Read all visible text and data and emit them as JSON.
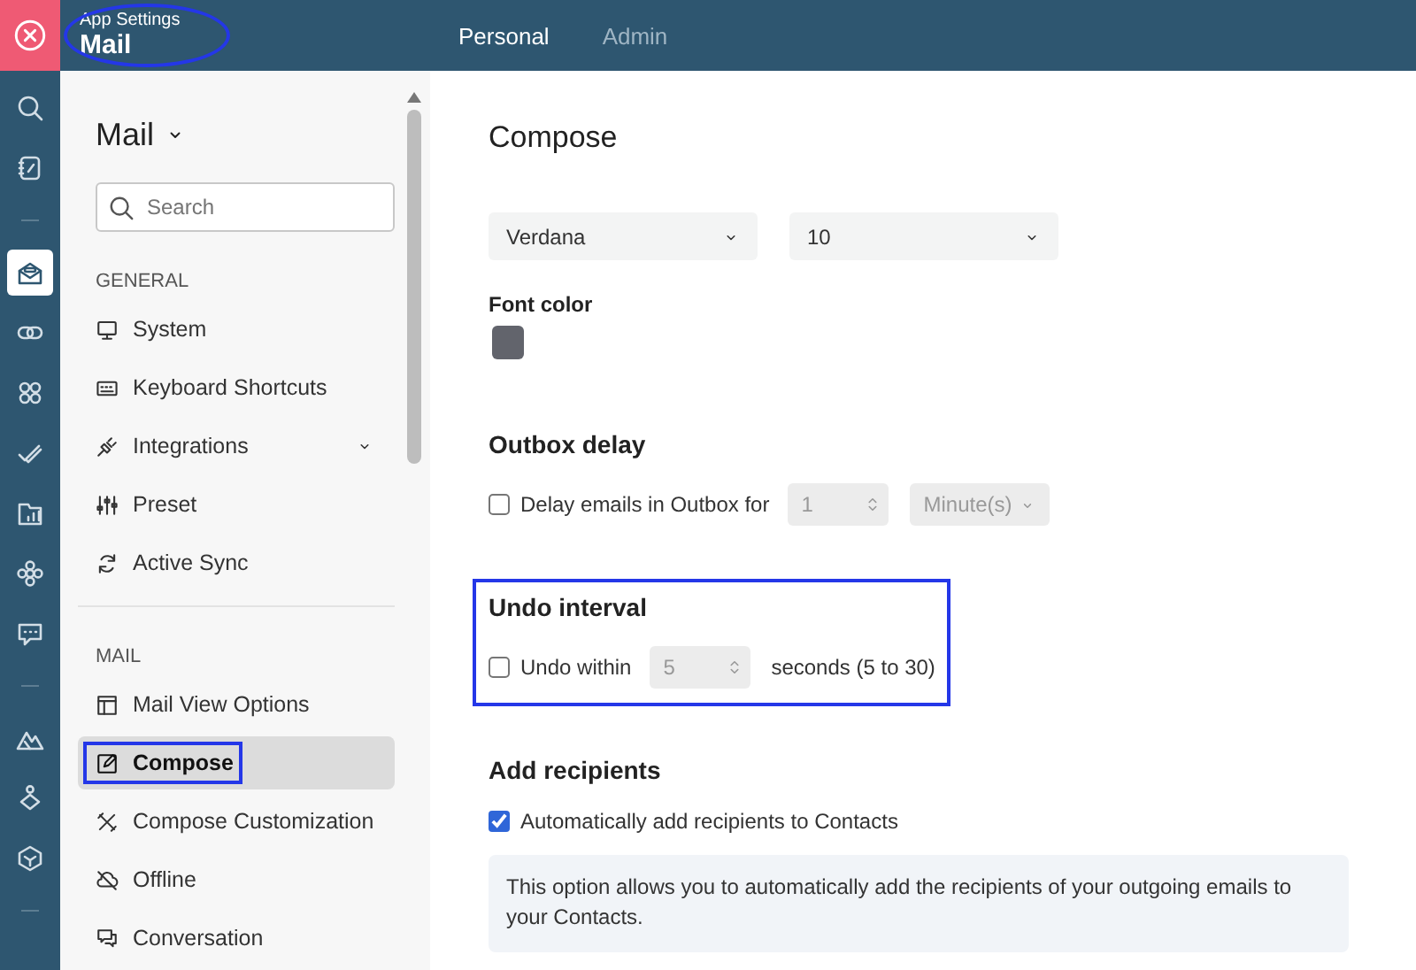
{
  "header": {
    "app_label": "App Settings",
    "title": "Mail",
    "title_circled": true,
    "tabs": [
      {
        "label": "Personal",
        "selected": true
      },
      {
        "label": "Admin",
        "selected": false
      }
    ]
  },
  "rail": {
    "groups": [
      [
        {
          "selected": false
        },
        {
          "selected": false
        }
      ],
      [
        {
          "selected": true
        },
        {
          "selected": false
        },
        {
          "selected": false
        },
        {
          "selected": false
        },
        {
          "selected": false
        },
        {
          "selected": false
        },
        {
          "selected": false
        }
      ],
      [
        {
          "selected": false
        },
        {
          "selected": false
        },
        {
          "selected": false
        }
      ]
    ]
  },
  "sidebar": {
    "title": "Mail",
    "search": {
      "placeholder": "Search"
    },
    "sections": [
      {
        "heading": "GENERAL",
        "items": [
          {
            "label": "System",
            "selected": false,
            "expandable": false,
            "boxed": false
          },
          {
            "label": "Keyboard Shortcuts",
            "selected": false,
            "expandable": false,
            "boxed": false
          },
          {
            "label": "Integrations",
            "selected": false,
            "expandable": true,
            "boxed": false
          },
          {
            "label": "Preset",
            "selected": false,
            "expandable": false,
            "boxed": false
          },
          {
            "label": "Active Sync",
            "selected": false,
            "expandable": false,
            "boxed": false
          }
        ]
      },
      {
        "heading": "MAIL",
        "items": [
          {
            "label": "Mail View Options",
            "selected": false,
            "expandable": false,
            "boxed": false
          },
          {
            "label": "Compose",
            "selected": true,
            "expandable": false,
            "boxed": true
          },
          {
            "label": "Compose Customization",
            "selected": false,
            "expandable": false,
            "boxed": false
          },
          {
            "label": "Offline",
            "selected": false,
            "expandable": false,
            "boxed": false
          },
          {
            "label": "Conversation",
            "selected": false,
            "expandable": false,
            "boxed": false
          }
        ]
      }
    ]
  },
  "main": {
    "heading": "Compose",
    "font_selects": [
      "Verdana",
      "10"
    ],
    "font_color": {
      "label": "Font color",
      "color": "#62646c"
    },
    "outbox": {
      "heading": "Outbox delay",
      "boxed": false,
      "checked": false,
      "label": "Delay emails in Outbox for",
      "value": "1",
      "disabled": true,
      "unit": "Minute(s)"
    },
    "undo": {
      "heading": "Undo interval",
      "boxed": true,
      "checked": false,
      "label": "Undo within",
      "value": "5",
      "disabled": true,
      "suffix": "seconds (5 to 30)"
    },
    "recipients": {
      "heading": "Add recipients",
      "checked": true,
      "label": "Automatically add recipients to Contacts",
      "note": "This option allows you to automatically add the recipients of your outgoing emails to your Contacts."
    }
  }
}
